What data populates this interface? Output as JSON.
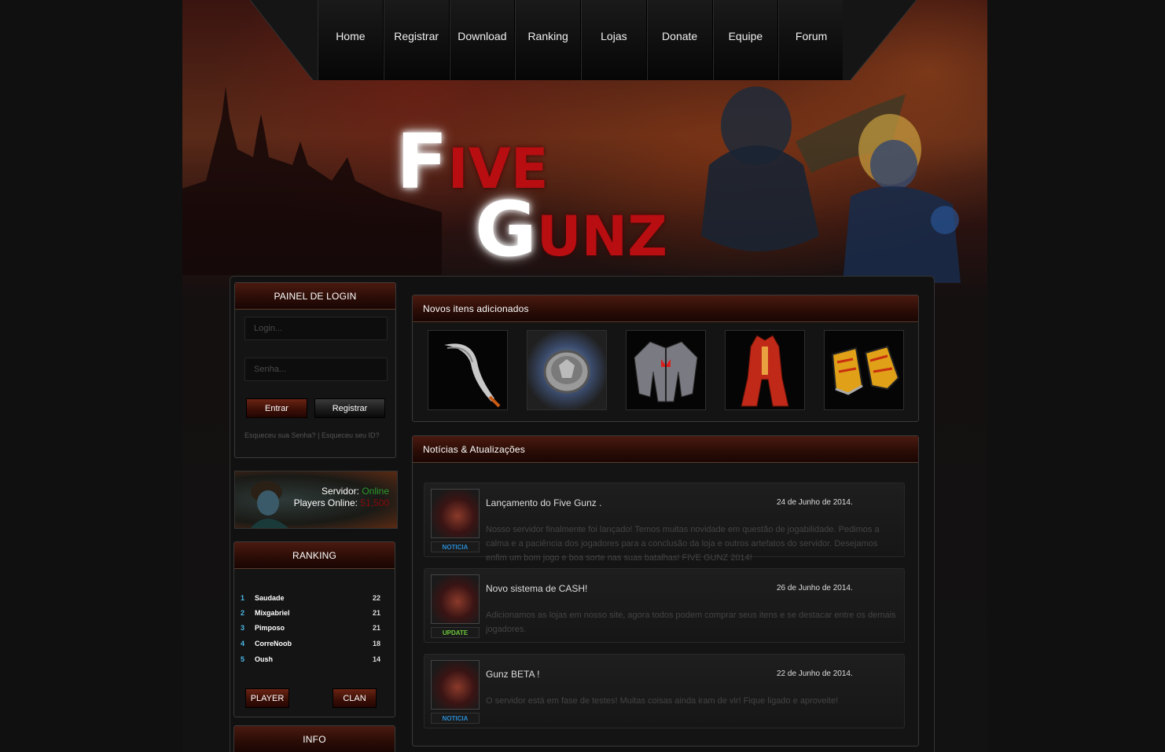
{
  "nav": [
    "Home",
    "Registrar",
    "Download",
    "Ranking",
    "Lojas",
    "Donate",
    "Equipe",
    "Forum"
  ],
  "logo": {
    "line1_initial": "F",
    "line1_rest": "IVE",
    "line2_initial": "G",
    "line2_rest": "UNZ"
  },
  "login": {
    "title": "PAINEL DE LOGIN",
    "login_placeholder": "Login...",
    "password_placeholder": "Senha...",
    "enter_label": "Entrar",
    "register_label": "Registrar",
    "forgot_password": "Esqueceu sua Senha?",
    "separator": "|",
    "forgot_id": "Esqueceu seu ID?"
  },
  "server": {
    "label": "Servidor:",
    "status": "Online",
    "players_label": "Players Online:",
    "players_count": "51,500"
  },
  "ranking": {
    "title": "RANKING",
    "rows": [
      {
        "pos": "1",
        "name": "Saudade",
        "score": "22"
      },
      {
        "pos": "2",
        "name": "Mixgabriel",
        "score": "21"
      },
      {
        "pos": "3",
        "name": "Pimposo",
        "score": "21"
      },
      {
        "pos": "4",
        "name": "CorreNoob",
        "score": "18"
      },
      {
        "pos": "5",
        "name": "Oush",
        "score": "14"
      }
    ],
    "player_label": "PLAYER",
    "clan_label": "CLAN"
  },
  "info": {
    "title": "INFO"
  },
  "new_items": {
    "title": "Novos itens adicionados",
    "icons": [
      "scythe-icon",
      "coin-icon",
      "jacket-icon",
      "red-coat-icon",
      "flame-shoes-icon"
    ]
  },
  "news": {
    "title": "Notícias & Atualizações",
    "posts": [
      {
        "title": "Lançamento do Five Gunz .",
        "date": "24 de Junho de 2014.",
        "tag": "NOTICIA",
        "tag_color": "#2a8ad0",
        "body": "Nosso servidor finalmente foi lançado! Temos muitas novidade em questão de jogabilidade. Pedimos a calma e a paciência dos jogadores para a conclusão da loja e outros artefatos do servidor. Desejamos enfim um bom jogo e boa sorte nas suas batalhas! FIVE GUNZ 2014!"
      },
      {
        "title": "Novo sistema de CASH!",
        "date": "26 de Junho de 2014.",
        "tag": "UPDATE",
        "tag_color": "#6ac83a",
        "body": "Adicionamos as lojas em nosso site, agora todos podem comprar seus itens e se destacar entre os demais jogadores."
      },
      {
        "title": "Gunz BETA !",
        "date": "22 de Junho de 2014.",
        "tag": "NOTICIA",
        "tag_color": "#2a8ad0",
        "body": "O servidor está em fase de testes! Muitas coisas ainda iram de vir! Fique ligado e aproveite!"
      }
    ]
  }
}
